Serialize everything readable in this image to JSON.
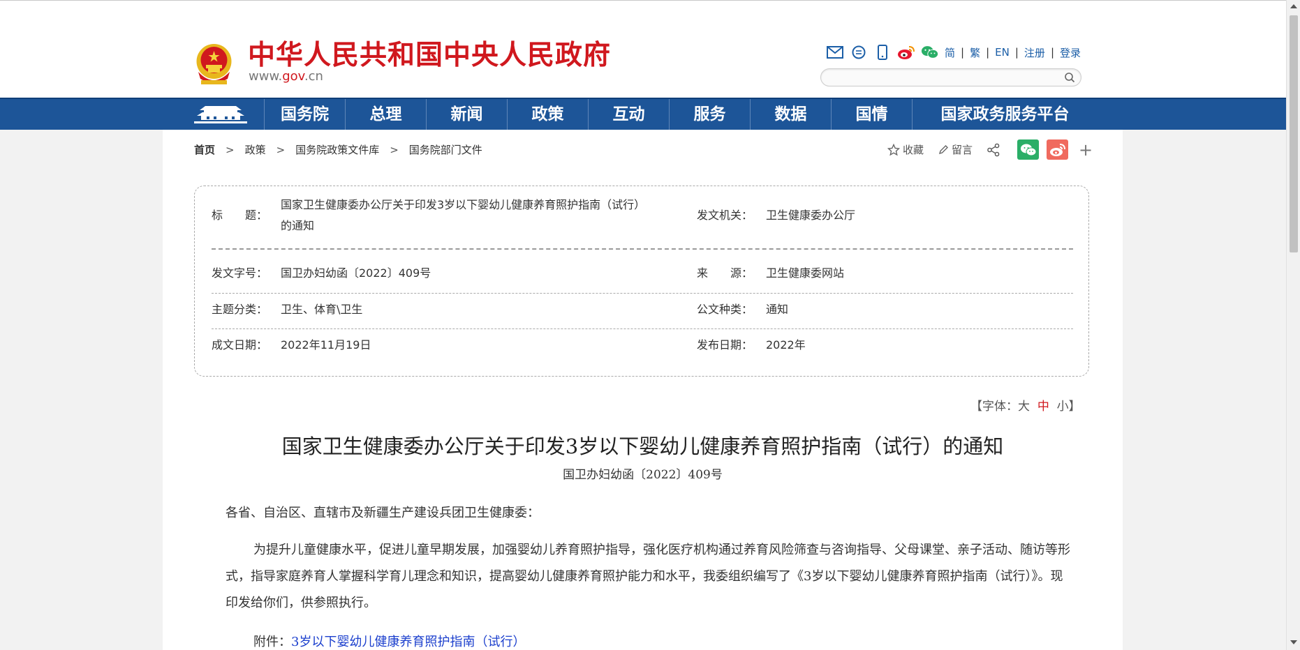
{
  "header": {
    "site_title": "中华人民共和国中央人民政府",
    "site_url_prefix": "www.",
    "site_url_mid": "gov",
    "site_url_suffix": ".cn",
    "lang_links": [
      "简",
      "繁",
      "EN"
    ],
    "register": "注册",
    "login": "登录",
    "search_placeholder": ""
  },
  "nav": {
    "items": [
      "国务院",
      "总理",
      "新闻",
      "政策",
      "互动",
      "服务",
      "数据",
      "国情",
      "国家政务服务平台"
    ]
  },
  "breadcrumb": [
    "首页",
    "政策",
    "国务院政策文件库",
    "国务院部门文件"
  ],
  "share": {
    "favorite": "收藏",
    "comment": "留言",
    "plus": "+"
  },
  "meta": {
    "title_label": "标　　题：",
    "title_value_line1": "国家卫生健康委办公厅关于印发3岁以下婴幼儿健康养育照护指南（试行）",
    "title_value_line2": "的通知",
    "issuer_label": "发文机关：",
    "issuer_value": "卫生健康委办公厅",
    "docno_label": "发文字号：",
    "docno_value": "国卫办妇幼函〔2022〕409号",
    "source_label": "来　　源：",
    "source_value": "卫生健康委网站",
    "topic_label": "主题分类：",
    "topic_value": "卫生、体育\\卫生",
    "type_label": "公文种类：",
    "type_value": "通知",
    "written_label": "成文日期：",
    "written_value": "2022年11月19日",
    "publish_label": "发布日期：",
    "publish_value": "2022年"
  },
  "fontsize": {
    "prefix": "【字体：",
    "large": "大",
    "medium": "中",
    "small": "小",
    "suffix": "】"
  },
  "doc": {
    "title": "国家卫生健康委办公厅关于印发3岁以下婴幼儿健康养育照护指南（试行）的通知",
    "number": "国卫办妇幼函〔2022〕409号",
    "salutation": "各省、自治区、直辖市及新疆生产建设兵团卫生健康委：",
    "paragraph": "为提升儿童健康水平，促进儿童早期发展，加强婴幼儿养育照护指导，强化医疗机构通过养育风险筛查与咨询指导、父母课堂、亲子活动、随访等形式，指导家庭养育人掌握科学育儿理念和知识，提高婴幼儿健康养育照护能力和水平，我委组织编写了《3岁以下婴幼儿健康养育照护指南（试行）》。现印发给你们，供参照执行。",
    "attachment_label": "附件：",
    "attachment_link": "3岁以下婴幼儿健康养育照护指南（试行）"
  },
  "colors": {
    "brand_red": "#d0181e",
    "nav_blue": "#1d5598",
    "link_blue": "#1b3fcd"
  }
}
